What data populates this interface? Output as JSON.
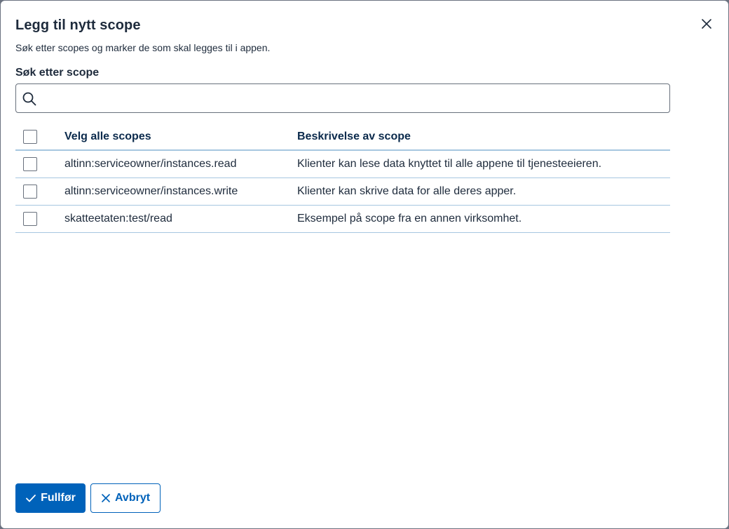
{
  "dialog": {
    "title": "Legg til nytt scope",
    "description": "Søk etter scopes og marker de som skal legges til i appen."
  },
  "search": {
    "label": "Søk etter scope",
    "value": "",
    "placeholder": ""
  },
  "table": {
    "headers": {
      "select_all": "Velg alle scopes",
      "description": "Beskrivelse av scope"
    },
    "rows": [
      {
        "scope": "altinn:serviceowner/instances.read",
        "description": "Klienter kan lese data knyttet til alle appene til tjenesteeieren.",
        "checked": false
      },
      {
        "scope": "altinn:serviceowner/instances.write",
        "description": "Klienter kan skrive data for alle deres apper.",
        "checked": false
      },
      {
        "scope": "skatteetaten:test/read",
        "description": "Eksempel på scope fra en annen virksomhet.",
        "checked": false
      }
    ]
  },
  "actions": {
    "confirm_label": "Fullfør",
    "cancel_label": "Avbryt"
  },
  "icons": {
    "close": "close-icon",
    "search": "search-icon",
    "confirm": "checkmark-icon",
    "cancel": "x-icon"
  },
  "colors": {
    "primary": "#0062ba",
    "border": "#68707c",
    "table_divider": "#a6c7e0",
    "text": "#1e2b3c"
  }
}
